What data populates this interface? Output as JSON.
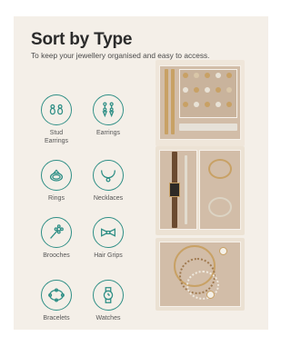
{
  "header": {
    "title": "Sort by Type",
    "subtitle": "To keep your jewellery organised and easy to access."
  },
  "categories": [
    {
      "label": "Stud\nEarrings",
      "icon": "stud-earrings-icon"
    },
    {
      "label": "Earrings",
      "icon": "earrings-icon"
    },
    {
      "label": "Rings",
      "icon": "ring-icon"
    },
    {
      "label": "Necklaces",
      "icon": "necklace-icon"
    },
    {
      "label": "Brooches",
      "icon": "brooch-icon"
    },
    {
      "label": "Hair Grips",
      "icon": "hair-grip-icon"
    },
    {
      "label": "Bracelets",
      "icon": "bracelet-icon"
    },
    {
      "label": "Watches",
      "icon": "watch-icon"
    }
  ],
  "colors": {
    "panel": "#f4efe8",
    "accent": "#2f8f86",
    "title": "#2b2b2b",
    "tray_lining": "#d2bda8",
    "gold": "#c8a165"
  }
}
